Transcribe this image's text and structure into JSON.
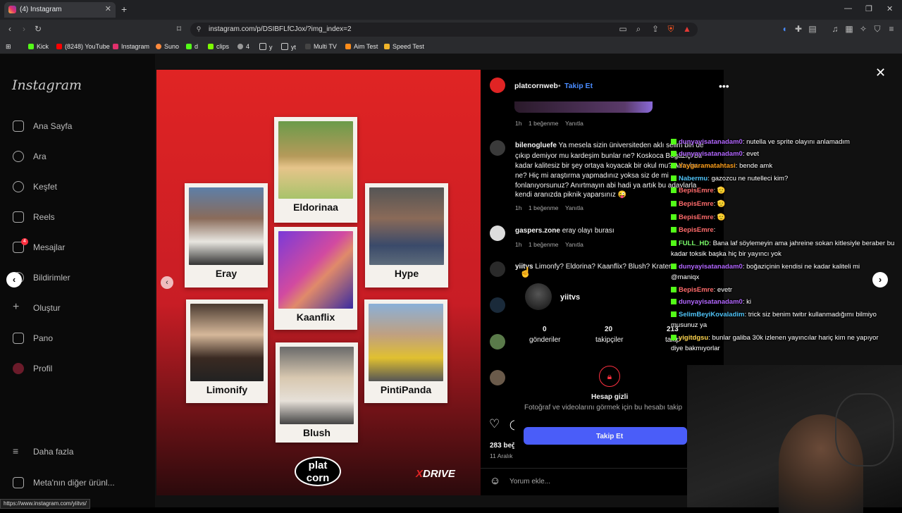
{
  "browser": {
    "tab_title": "(4) Instagram",
    "url": "instagram.com/p/DSIBFLfCJox/?img_index=2",
    "bookmarks": [
      "Kick",
      "(8248) YouTube",
      "Instagram",
      "Suno",
      "d",
      "clips",
      "4",
      "y",
      "yt",
      "Multi TV",
      "Aim Test",
      "Speed Test"
    ],
    "status_url": "https://www.instagram.com/yiitvs/"
  },
  "sidebar": {
    "logo": "Instagram",
    "items": [
      "Ana Sayfa",
      "Ara",
      "Keşfet",
      "Reels",
      "Mesajlar",
      "Bildirimler",
      "Oluştur",
      "Pano",
      "Profil"
    ],
    "messages_badge": "4",
    "more": "Daha fazla",
    "meta": "Meta'nın diğer ürünl..."
  },
  "post": {
    "cards": [
      "Eldorinaa",
      "Eray",
      "Hype",
      "Kaanflix",
      "Limonify",
      "PintiPanda",
      "Blush"
    ],
    "logo_left": "plat corn",
    "logo_right": "DRIVE"
  },
  "panel": {
    "username": "platcornweb",
    "follow": "Takip Et",
    "c0_time": "1h",
    "c0_likes": "1 beğenme",
    "reply": "Yanıtla",
    "c1_user": "bilenogluefe",
    "c1_lines": [
      "Ya mesela sizin üniversiteden aklı selim biri de",
      "çıkıp demiyor mu kardeşim bunlar ne? Koskoca Boğaziçi bu",
      "kadar kalitesiz bir şey ortaya koyacak bir okul mu? Adaylar",
      "ne? Hiç mi araştırma yapmadınız yoksa siz de mi",
      "fonlanıyorsunuz? Anırtmayın abi hadi ya artık bu adaylarla",
      "kendi aranızda piknik yaparsınız 😜"
    ],
    "c1_time": "1h",
    "c1_likes": "1 beğenme",
    "c2_user": "gaspers.zone",
    "c2_text": "eray olayı burası",
    "c2_time": "1h",
    "c2_likes": "1 beğenme",
    "c3_user": "yiitvs",
    "c3_text": "Limonfy? Eldorina? Kaanflix? Blush? Kratern",
    "likes": "283 beğ",
    "date": "11 Aralık",
    "comment_placeholder": "Yorum ekle..."
  },
  "profile_popup": {
    "username": "yiitvs",
    "posts": "0",
    "posts_label": "gönderiler",
    "followers": "20",
    "followers_label": "takipçiler",
    "following": "213",
    "following_label": "takip",
    "private_title": "Hesap gizli",
    "private_text": "Fotoğraf ve videolarını görmek için bu hesabı takip",
    "follow_button": "Takip Et"
  },
  "chat": [
    {
      "user": "dunyayisatanadam0",
      "text": "nutella ve sprite olayını anlamadım",
      "color": "#b266ff"
    },
    {
      "user": "dunyayisatanadam0",
      "text": "evet",
      "color": "#b266ff"
    },
    {
      "user": "Yaygaramatahtasi",
      "text": "bende amk",
      "color": "#ff9f1a"
    },
    {
      "user": "Nabermu",
      "text": "gazozcu ne nutelleci kim?",
      "color": "#4fc3f7"
    },
    {
      "user": "BepisEmre",
      "text": "🫡",
      "color": "#ff6b6b"
    },
    {
      "user": "BepisEmre",
      "text": "🫡",
      "color": "#ff6b6b"
    },
    {
      "user": "BepisEmre",
      "text": "🫡",
      "color": "#ff6b6b"
    },
    {
      "user": "BepisEmre",
      "text": "",
      "color": "#ff6b6b"
    },
    {
      "user": "FULL_HD",
      "text": "Bana laf söylemeyin ama jahreine sokan kitlesiyle beraber bu",
      "color": "#7cff6b"
    },
    {
      "user": "",
      "text": "kadar toksik başka hiç bir yayıncı yok",
      "color": "#fff"
    },
    {
      "user": "dunyayisatanadam0",
      "text": "boğaziçinin kendisi ne kadar kaliteli mi",
      "color": "#b266ff"
    },
    {
      "user": "",
      "text": "@maniqx",
      "color": "#fff"
    },
    {
      "user": "BepisEmre",
      "text": "evetr",
      "color": "#ff6b6b"
    },
    {
      "user": "dunyayisatanadam0",
      "text": "ki",
      "color": "#b266ff"
    },
    {
      "user": "SelimBeyiKovaladim",
      "text": "trick siz benim twitır kullanmadığımı bilmiyo",
      "color": "#4fc3f7"
    },
    {
      "user": "",
      "text": "musunuz ya",
      "color": "#fff"
    },
    {
      "user": "yigitdgsu",
      "text": "bunlar galiba 30k izlenen yayıncılar hariç kim ne yapıyor",
      "color": "#ffd54f"
    },
    {
      "user": "",
      "text": "diye bakmıyorlar",
      "color": "#fff"
    }
  ]
}
